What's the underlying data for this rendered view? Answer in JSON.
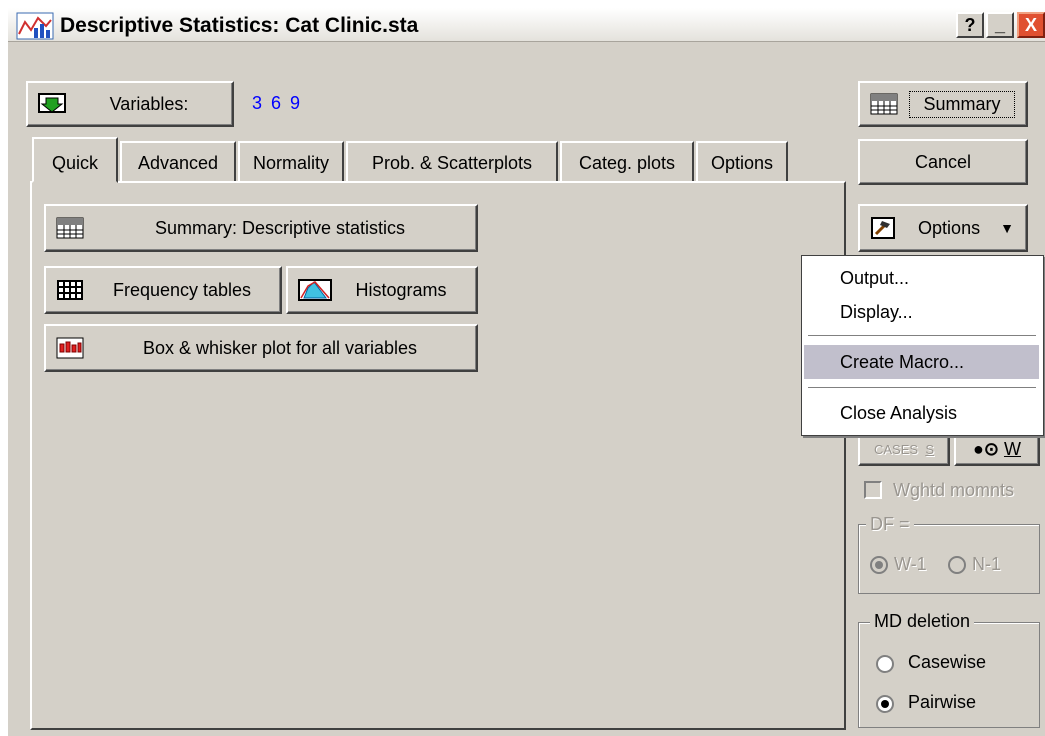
{
  "window": {
    "title": "Descriptive Statistics: Cat Clinic.sta",
    "help": "?",
    "minimize": "_",
    "close": "X"
  },
  "variables": {
    "button_label": "Variables:",
    "value": "3 6 9"
  },
  "tabs": [
    {
      "label": "Quick",
      "active": true
    },
    {
      "label": "Advanced"
    },
    {
      "label": "Normality"
    },
    {
      "label": "Prob. & Scatterplots"
    },
    {
      "label": "Categ. plots"
    },
    {
      "label": "Options"
    }
  ],
  "quick": {
    "summary": "Summary: Descriptive statistics",
    "frequency": "Frequency tables",
    "histograms": "Histograms",
    "boxwhisker": "Box & whisker plot for all variables"
  },
  "right": {
    "summary": "Summary",
    "cancel": "Cancel",
    "options": "Options",
    "cases_btn": "CASES",
    "cases_key": "S",
    "weight_key": "W",
    "wghtd": "Wghtd momnts",
    "df_label": "DF =",
    "df_w": "W-1",
    "df_n": "N-1",
    "md_label": "MD deletion",
    "casewise": "Casewise",
    "pairwise": "Pairwise"
  },
  "menu": {
    "output": "Output...",
    "display": "Display...",
    "create_macro": "Create Macro...",
    "close_analysis": "Close Analysis"
  },
  "colors": {
    "value_blue": "#0000ff",
    "menu_highlight": "#c1bfcc",
    "face": "#d4d0c8"
  }
}
